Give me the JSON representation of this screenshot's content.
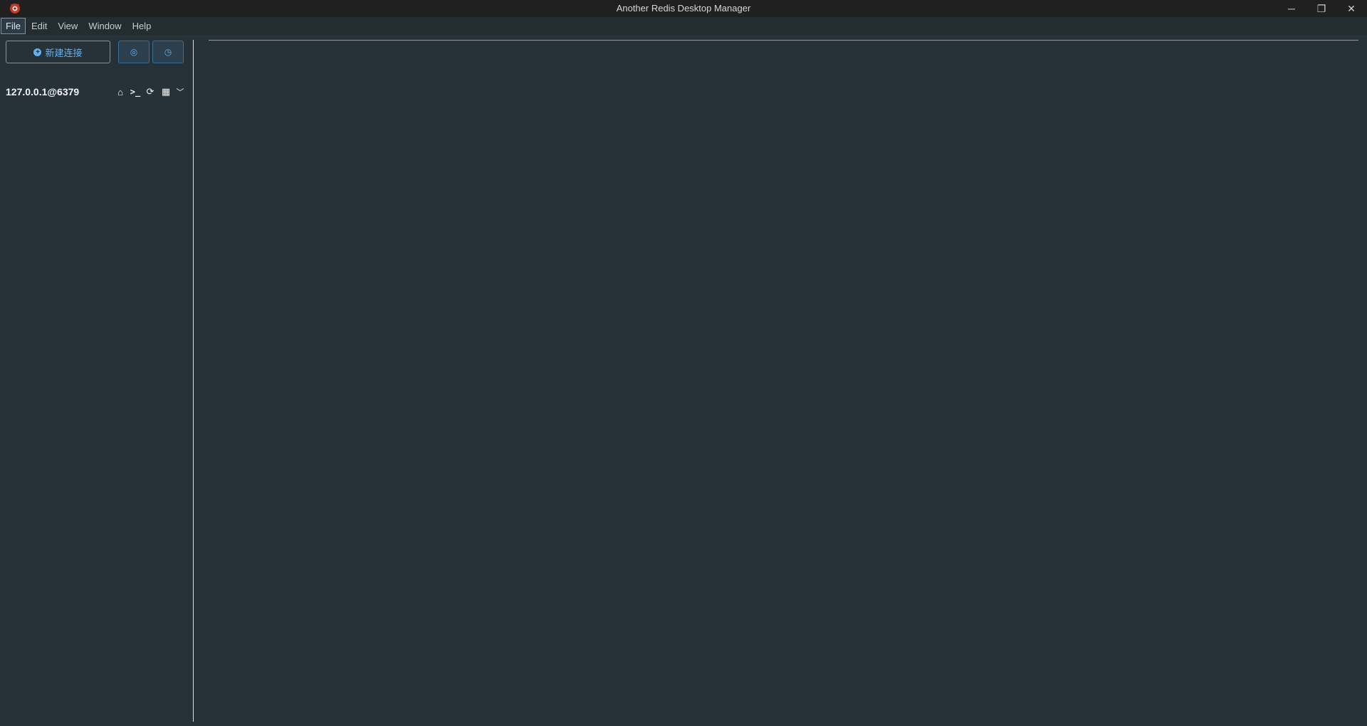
{
  "window": {
    "title": "Another Redis Desktop Manager",
    "app_icon": "redis-logo-icon",
    "controls": {
      "minimize": "─",
      "maximize": "❐",
      "close": "✕"
    }
  },
  "menubar": {
    "items": [
      {
        "label": "File",
        "active": true
      },
      {
        "label": "Edit"
      },
      {
        "label": "View"
      },
      {
        "label": "Window"
      },
      {
        "label": "Help"
      }
    ]
  },
  "sidebar": {
    "new_connection_label": "新建连接",
    "settings_icon": "◎",
    "history_icon": "◷",
    "connection": {
      "name": "127.0.0.1@6379",
      "icons": {
        "home": "⌂",
        "terminal": ">_",
        "refresh": "⟳",
        "grid": "▦",
        "chevron": "﹀"
      }
    }
  },
  "colors": {
    "background": "#263238",
    "accent": "#63b3f2",
    "titlebar": "#202020"
  }
}
